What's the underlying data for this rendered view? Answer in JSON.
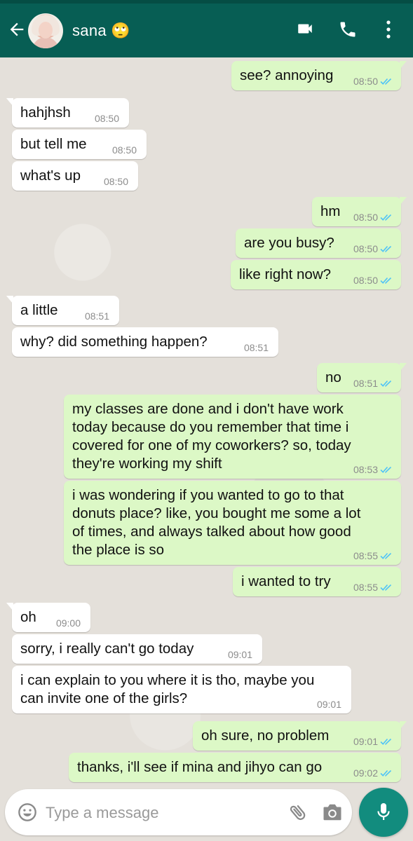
{
  "header": {
    "contact_name": "sana 🙄"
  },
  "messages": [
    {
      "dir": "out",
      "text": "see? annoying",
      "time": "08:50"
    },
    {
      "dir": "in",
      "text": "hahjhsh",
      "time": "08:50"
    },
    {
      "dir": "in",
      "text": "but tell me",
      "time": "08:50"
    },
    {
      "dir": "in",
      "text": "what's up",
      "time": "08:50"
    },
    {
      "dir": "out",
      "text": "hm",
      "time": "08:50"
    },
    {
      "dir": "out",
      "text": "are you busy?",
      "time": "08:50"
    },
    {
      "dir": "out",
      "text": "like right now?",
      "time": "08:50"
    },
    {
      "dir": "in",
      "text": "a little",
      "time": "08:51"
    },
    {
      "dir": "in",
      "text": "why? did something happen?",
      "time": "08:51"
    },
    {
      "dir": "out",
      "text": "no",
      "time": "08:51"
    },
    {
      "dir": "out",
      "text": "my classes are done and i don't have work\ntoday because do you remember that time i\ncovered for one of my coworkers? so, today\nthey're working my shift",
      "time": "08:53"
    },
    {
      "dir": "out",
      "text": "i was wondering if you wanted to go to that\ndonuts place? like, you bought me some a lot\nof times, and always talked about how good\nthe place is so",
      "time": "08:55"
    },
    {
      "dir": "out",
      "text": "i wanted to try",
      "time": "08:55"
    },
    {
      "dir": "in",
      "text": "oh",
      "time": "09:00"
    },
    {
      "dir": "in",
      "text": "sorry, i really can't go today",
      "time": "09:01"
    },
    {
      "dir": "in",
      "text": "i can explain to you where it is tho, maybe you\ncan invite one of the girls?",
      "time": "09:01"
    },
    {
      "dir": "out",
      "text": "oh sure, no problem",
      "time": "09:01"
    },
    {
      "dir": "out",
      "text": "thanks, i'll see if mina and jihyo can go",
      "time": "09:02"
    }
  ],
  "input": {
    "placeholder": "Type a message"
  },
  "colors": {
    "header": "#075e54",
    "outgoing_bubble": "#dcf8c6",
    "incoming_bubble": "#ffffff",
    "read_ticks": "#4fc3f7",
    "mic_button": "#128c7e"
  }
}
